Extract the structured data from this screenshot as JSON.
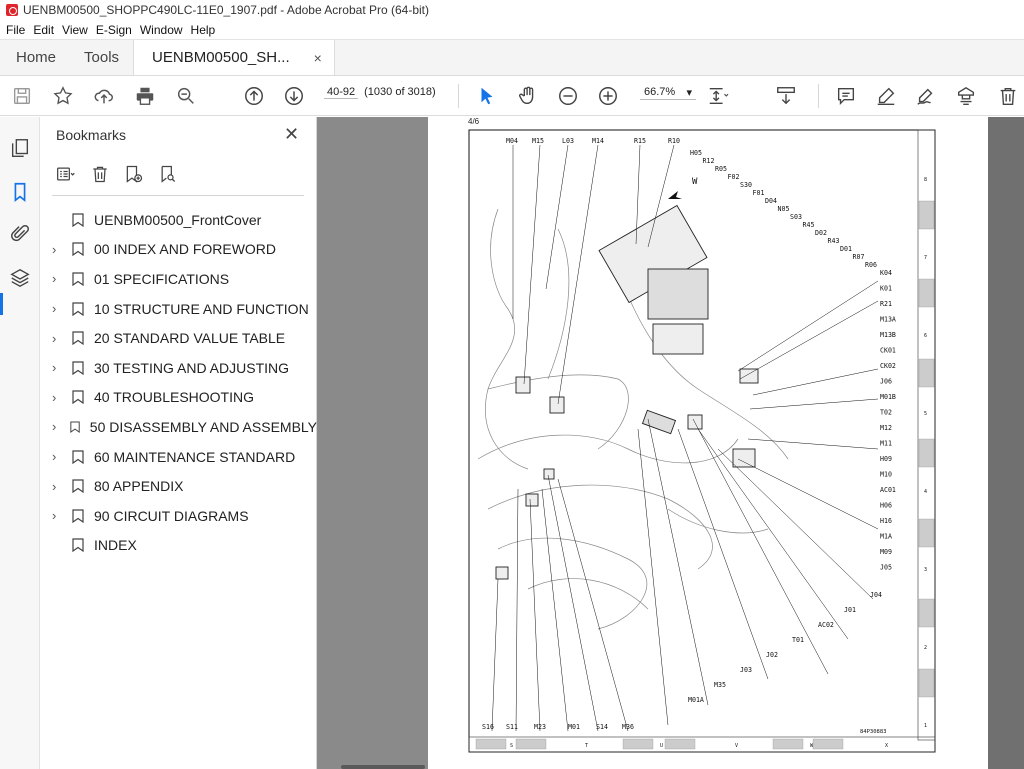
{
  "window": {
    "title": "UENBM00500_SHOPPC490LC-11E0_1907.pdf - Adobe Acrobat Pro (64-bit)"
  },
  "menu": [
    "File",
    "Edit",
    "View",
    "E-Sign",
    "Window",
    "Help"
  ],
  "tabs": {
    "home": "Home",
    "tools": "Tools",
    "document": "UENBM00500_SH...",
    "close": "×"
  },
  "toolbar": {
    "page_input": "40-92",
    "page_count": "(1030 of 3018)",
    "zoom": "66.7%",
    "zoom_arrow": "▾"
  },
  "bookmarks": {
    "header": "Bookmarks",
    "close": "✕",
    "items": [
      {
        "label": "UENBM00500_FrontCover",
        "expandable": false
      },
      {
        "label": "00 INDEX AND FOREWORD",
        "expandable": true
      },
      {
        "label": "01 SPECIFICATIONS",
        "expandable": true
      },
      {
        "label": "10 STRUCTURE AND FUNCTION",
        "expandable": true
      },
      {
        "label": "20 STANDARD VALUE TABLE",
        "expandable": true
      },
      {
        "label": "30 TESTING AND ADJUSTING",
        "expandable": true
      },
      {
        "label": "40 TROUBLESHOOTING",
        "expandable": true
      },
      {
        "label": "50 DISASSEMBLY AND ASSEMBLY",
        "expandable": true
      },
      {
        "label": "60 MAINTENANCE STANDARD",
        "expandable": true
      },
      {
        "label": "80 APPENDIX",
        "expandable": true
      },
      {
        "label": "90 CIRCUIT DIAGRAMS",
        "expandable": true
      },
      {
        "label": "INDEX",
        "expandable": false
      }
    ]
  },
  "document_page": {
    "page_label": "4/6",
    "drawing_no": "84P30883",
    "view_mark": "W",
    "top_labels": [
      "M04",
      "M15",
      "L03",
      "M14",
      "R15",
      "R10"
    ],
    "right_labels": [
      "H05",
      "R12",
      "R05",
      "F02",
      "S30",
      "F01",
      "D04",
      "N05",
      "S03",
      "R45",
      "D02",
      "R43",
      "D01",
      "R07",
      "R06",
      "K04",
      "K01",
      "R21",
      "M13A",
      "M13B",
      "CK01",
      "CK02",
      "J06",
      "M01B",
      "T02",
      "M12",
      "M11",
      "H09",
      "M10",
      "AC01",
      "H06",
      "H16",
      "M1A",
      "M09",
      "J05",
      "J04",
      "J01",
      "AC02",
      "T01",
      "J02",
      "J03",
      "M35",
      "M01A"
    ],
    "bottom_labels": [
      "S16",
      "S11",
      "M23",
      "M01",
      "S14",
      "M36"
    ],
    "grid_rows": [
      "8",
      "7",
      "6",
      "5",
      "4",
      "3",
      "2",
      "1"
    ],
    "grid_cols": [
      "S",
      "T",
      "U",
      "V",
      "W",
      "X"
    ]
  }
}
